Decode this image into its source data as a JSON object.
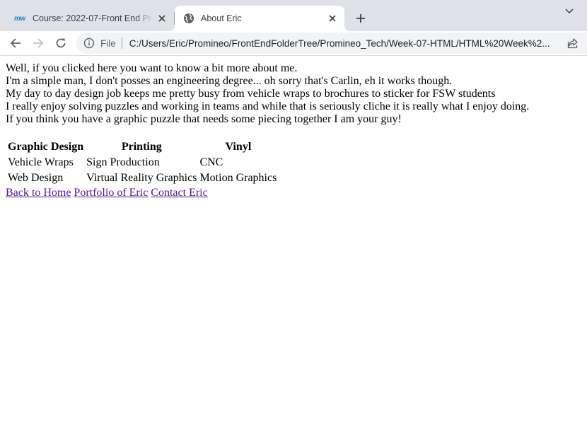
{
  "browser": {
    "tabs": [
      {
        "favicon": "mw-logo-icon",
        "title": "Course: 2022-07-Front End Programming"
      },
      {
        "favicon": "globe-icon",
        "title": "About Eric"
      }
    ],
    "address_bar": {
      "chip": "File",
      "url": "C:/Users/Eric/Promineo/FrontEndFolderTree/Promineo_Tech/Week-07-HTML/HTML%20Week%2..."
    }
  },
  "page": {
    "intro_lines": [
      "Well, if you clicked here you want to know a bit more about me.",
      "I'm a simple man, I don't posses an engineering degree... oh sorry that's Carlin, eh it works though.",
      "My day to day design job keeps me pretty busy from vehicle wraps to brochures to sticker for FSW students",
      "I really enjoy solving puzzles and working in teams and while that is seriously cliche it is really what I enjoy doing.",
      "If you think you have a graphic puzzle that needs some piecing together I am your guy!"
    ],
    "services_table": {
      "headers": [
        "Graphic Design",
        "Printing",
        "Vinyl"
      ],
      "rows": [
        [
          "Vehicle Wraps",
          "Sign Production",
          "CNC"
        ],
        [
          "Web Design",
          "Virtual Reality Graphics",
          "Motion Graphics"
        ]
      ]
    },
    "links": [
      {
        "label": "Back to Home"
      },
      {
        "label": "Portfolio of Eric"
      },
      {
        "label": "Contact Eric"
      }
    ]
  },
  "colors": {
    "tabstrip_bg": "#dee1e6",
    "omnibox_bg": "#f1f3f4",
    "visited_link": "#551a8b"
  }
}
